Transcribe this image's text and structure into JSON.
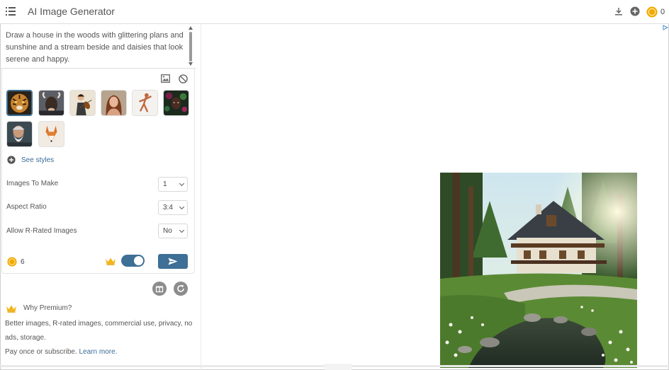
{
  "header": {
    "title": "AI Image Generator",
    "coin_count": "0"
  },
  "prompt": {
    "text": "Draw a house in the woods with glittering plans and sunshine and a stream beside and daisies that look serene and happy."
  },
  "styles": {
    "items": [
      {
        "name": "tiger",
        "selected": true
      },
      {
        "name": "bull"
      },
      {
        "name": "violinist"
      },
      {
        "name": "woman-portrait"
      },
      {
        "name": "dancer-sketch"
      },
      {
        "name": "floral-face"
      },
      {
        "name": "old-man"
      },
      {
        "name": "fox"
      }
    ],
    "see_styles_label": "See styles"
  },
  "options": {
    "images_to_make": {
      "label": "Images To Make",
      "value": "1"
    },
    "aspect_ratio": {
      "label": "Aspect Ratio",
      "value": "3:4"
    },
    "allow_r_rated": {
      "label": "Allow R-Rated Images",
      "value": "No"
    }
  },
  "footer_controls": {
    "coin_count": "6",
    "premium_toggle_on": true
  },
  "premium": {
    "title": "Why Premium?",
    "line1": "Better images, R-rated images, commercial use, privacy, no ads, storage.",
    "line2": "Pay once or subscribe.",
    "learn_more": "Learn more."
  },
  "colors": {
    "accent": "#3e6f96",
    "coin": "#f2a900",
    "crown": "#f3b51b"
  }
}
